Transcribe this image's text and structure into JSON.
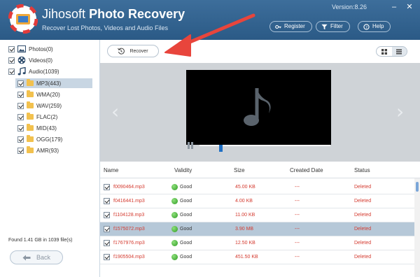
{
  "header": {
    "brand": "Jihosoft",
    "product": "Photo Recovery",
    "subtitle": "Recover Lost Photos, Videos and Audio Files",
    "version": "Version:8.26",
    "buttons": {
      "register": "Register",
      "filter": "Filter",
      "help": "Help"
    }
  },
  "sidebar": {
    "top_items": [
      {
        "label": "Photos(0)",
        "icon": "photo-icon"
      },
      {
        "label": "Videos(0)",
        "icon": "film-reel-icon"
      },
      {
        "label": "Audio(1039)",
        "icon": "music-note-icon"
      }
    ],
    "sub_items": [
      {
        "label": "MP3(443)",
        "selected": true
      },
      {
        "label": "WMA(20)"
      },
      {
        "label": "WAV(259)"
      },
      {
        "label": "FLAC(2)"
      },
      {
        "label": "MID(43)"
      },
      {
        "label": "OGG(179)"
      },
      {
        "label": "AMR(93)"
      }
    ],
    "found": "Found 1.41 GB in 1039 file(s)",
    "back": "Back"
  },
  "toolbar": {
    "recover": "Recover"
  },
  "preview": {
    "progress": 0.16
  },
  "table": {
    "columns": [
      "Name",
      "Validity",
      "Size",
      "Created Date",
      "Status"
    ],
    "rows": [
      {
        "name": "f0090464.mp3",
        "validity": "Good",
        "size": "45.00 KB",
        "created": "---",
        "status": "Deleted"
      },
      {
        "name": "f0416441.mp3",
        "validity": "Good",
        "size": "4.00 KB",
        "created": "---",
        "status": "Deleted"
      },
      {
        "name": "f1104128.mp3",
        "validity": "Good",
        "size": "11.00 KB",
        "created": "---",
        "status": "Deleted"
      },
      {
        "name": "f1575072.mp3",
        "validity": "Good",
        "size": "3.90 MB",
        "created": "---",
        "status": "Deleted"
      },
      {
        "name": "f1767976.mp3",
        "validity": "Good",
        "size": "12.50 KB",
        "created": "---",
        "status": "Deleted"
      },
      {
        "name": "f1905504.mp3",
        "validity": "Good",
        "size": "451.50 KB",
        "created": "---",
        "status": "Deleted"
      }
    ]
  },
  "colors": {
    "header": "#2f5f8c",
    "accent_arrow": "#e8453c",
    "deleted_text": "#d43a2f"
  }
}
